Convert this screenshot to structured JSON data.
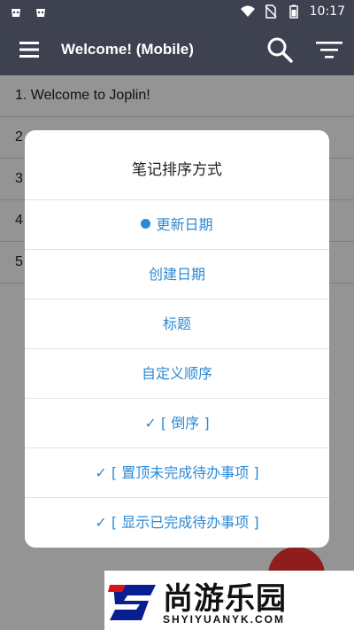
{
  "status_bar": {
    "time": "10:17"
  },
  "app_bar": {
    "title": "Welcome! (Mobile)"
  },
  "notes": [
    {
      "label": "1. Welcome to Joplin!"
    },
    {
      "label": "2"
    },
    {
      "label": "3"
    },
    {
      "label": "4"
    },
    {
      "label": "5"
    }
  ],
  "dialog": {
    "title": "笔记排序方式",
    "options": [
      {
        "label": "更新日期",
        "selected": true
      },
      {
        "label": "创建日期"
      },
      {
        "label": "标题"
      },
      {
        "label": "自定义顺序"
      },
      {
        "label": "✓ [ 倒序 ]"
      },
      {
        "label": "✓ [ 置顶未完成待办事项 ]"
      },
      {
        "label": "✓ [ 显示已完成待办事项 ]"
      }
    ]
  },
  "watermark": {
    "brand": "尚游乐园",
    "domain": "SHYIYUANYK.COM"
  },
  "colors": {
    "app_bar": "#3d4150",
    "accent": "#2b8ad6",
    "fab": "#8f1d1d"
  },
  "icons": [
    "menu-icon",
    "search-icon",
    "sort-icon",
    "wifi-icon",
    "battery-icon"
  ]
}
